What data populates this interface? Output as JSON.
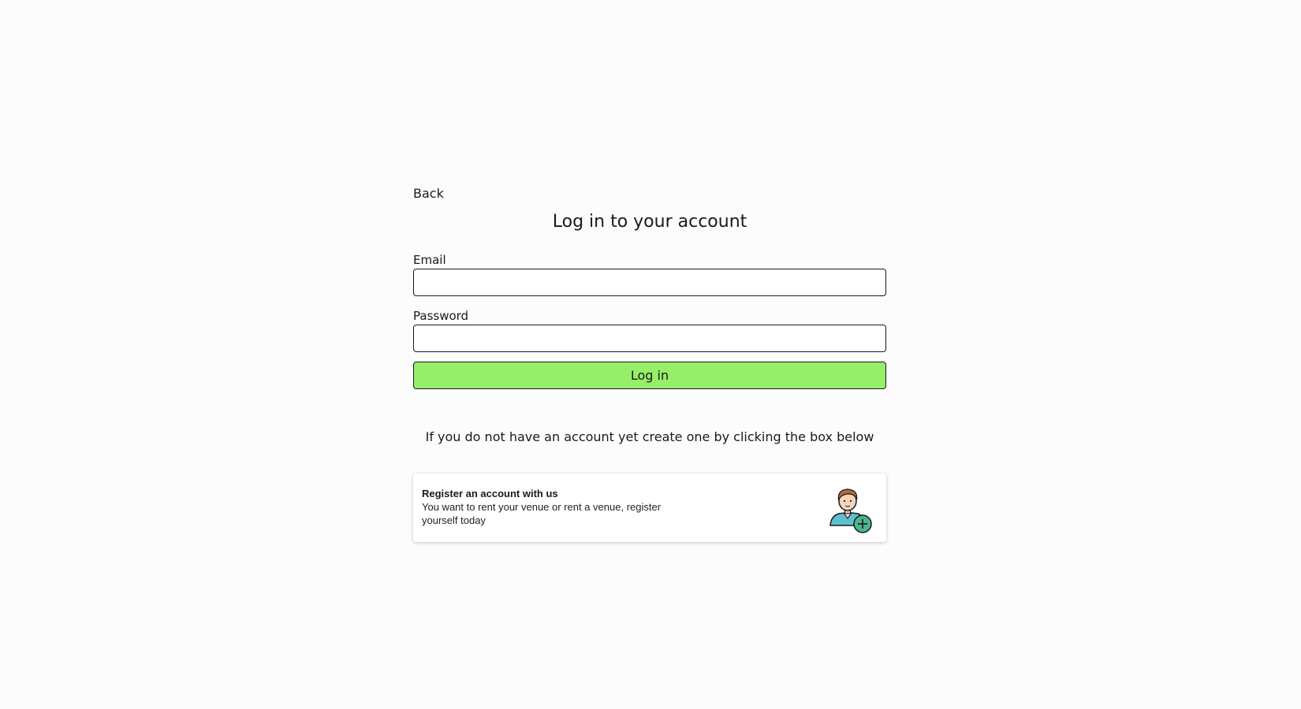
{
  "nav": {
    "back_label": "Back"
  },
  "login": {
    "title": "Log in to your account",
    "email_label": "Email",
    "email_value": "",
    "password_label": "Password",
    "password_value": "",
    "submit_label": "Log in",
    "submit_color": "#96ef68"
  },
  "register": {
    "hint": "If you do not have an account yet create one by clicking the box below",
    "card_title": "Register an account with us",
    "card_description": "You want to rent your venue or rent a venue, register yourself today",
    "card_icon": "add-user-icon"
  }
}
